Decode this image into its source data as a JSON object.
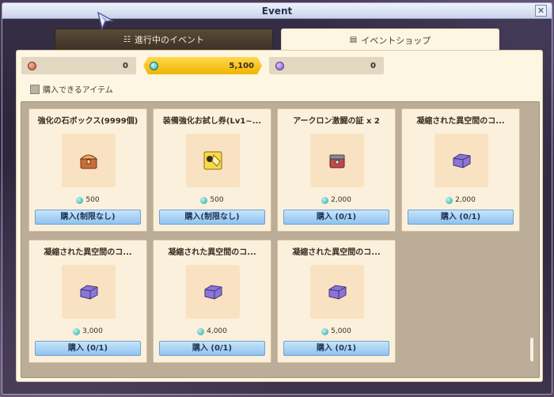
{
  "window": {
    "title": "Event",
    "close_label": "✕"
  },
  "tabs": [
    {
      "label": "進行中のイベント",
      "icon": "calendar-icon",
      "active": false
    },
    {
      "label": "イベントショップ",
      "icon": "shop-icon",
      "active": true
    }
  ],
  "currencies": [
    {
      "icon": "brown-medal-icon",
      "value": "0",
      "color": "#c0553a"
    },
    {
      "icon": "teal-coin-icon",
      "value": "5,100",
      "color": "#1ea7a0"
    },
    {
      "icon": "purple-orb-icon",
      "value": "0",
      "color": "#8a56c8"
    }
  ],
  "filter": {
    "label": "購入できるアイテム",
    "checked": false
  },
  "items": [
    {
      "name": "強化の石ボックス(9999個)",
      "icon": "treasure-box-icon",
      "price": "500",
      "buy_label": "購入(制限なし)"
    },
    {
      "name": "装備強化お試し券(Lv1~...",
      "icon": "ticket-icon",
      "price": "500",
      "buy_label": "購入(制限なし)"
    },
    {
      "name": "アークロン激闘の証 x 2",
      "icon": "chest-icon",
      "price": "2,000",
      "buy_label": "購入 (0/1)"
    },
    {
      "name": "凝縮された異空間のコ...",
      "icon": "purple-cube-icon",
      "price": "2,000",
      "buy_label": "購入 (0/1)"
    },
    {
      "name": "凝縮された異空間のコ...",
      "icon": "purple-cube-icon",
      "price": "3,000",
      "buy_label": "購入 (0/1)"
    },
    {
      "name": "凝縮された異空間のコ...",
      "icon": "purple-cube-icon",
      "price": "4,000",
      "buy_label": "購入 (0/1)"
    },
    {
      "name": "凝縮された異空間のコ...",
      "icon": "purple-cube-icon",
      "price": "5,000",
      "buy_label": "購入 (0/1)"
    }
  ]
}
